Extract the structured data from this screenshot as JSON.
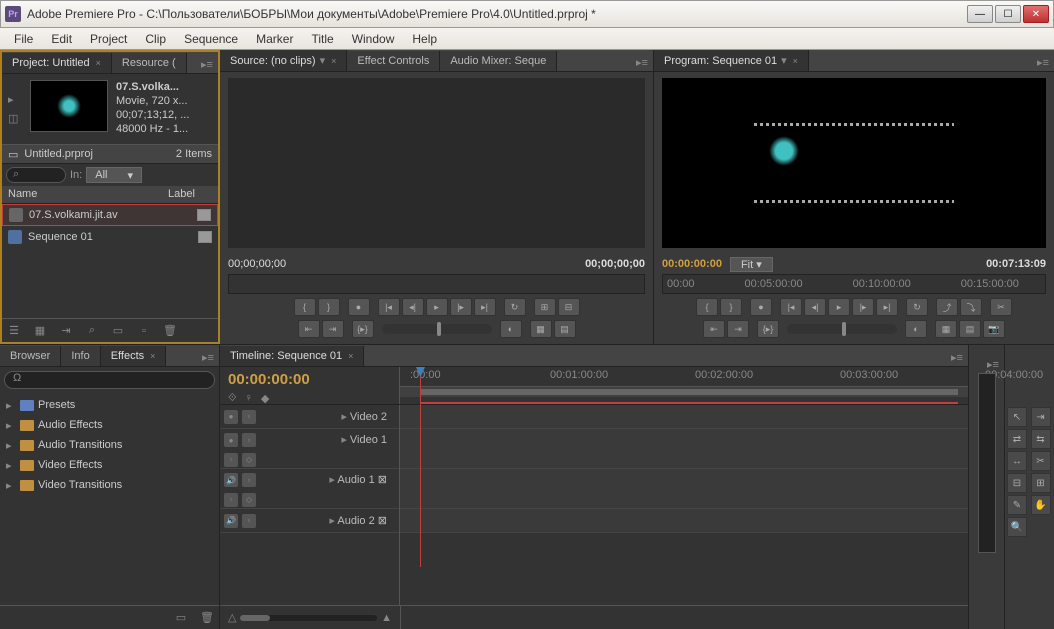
{
  "window": {
    "title": "Adobe Premiere Pro - C:\\Пользователи\\БОБРЫ\\Мои документы\\Adobe\\Premiere Pro\\4.0\\Untitled.prproj *",
    "app_icon": "Pr"
  },
  "menubar": [
    "File",
    "Edit",
    "Project",
    "Clip",
    "Sequence",
    "Marker",
    "Title",
    "Window",
    "Help"
  ],
  "project_panel": {
    "tab_project": "Project: Untitled",
    "tab_resource": "Resource (",
    "selected_clip": {
      "name": "07.S.volka...",
      "type": "Movie, 720 x...",
      "duration": "00;07;13;12, ...",
      "audio": "48000 Hz - 1..."
    },
    "project_name": "Untitled.prproj",
    "item_count": "2 Items",
    "in_label": "In:",
    "in_value": "All",
    "col_name": "Name",
    "col_label": "Label",
    "items": [
      {
        "name": "07.S.volkami.jit.av",
        "selected": true
      },
      {
        "name": "Sequence 01",
        "selected": false
      }
    ]
  },
  "source_panel": {
    "tab_source": "Source: (no clips)",
    "tab_fx": "Effect Controls",
    "tab_audio": "Audio Mixer: Seque",
    "tc_left": "00;00;00;00",
    "tc_right": "00;00;00;00"
  },
  "program_panel": {
    "tab": "Program: Sequence 01",
    "tc_left": "00:00:00:00",
    "fit": "Fit",
    "tc_right": "00:07:13:09",
    "ruler": [
      "00:00",
      "00:05:00:00",
      "00:10:00:00",
      "00:15:00:00"
    ]
  },
  "effects_panel": {
    "tab_browser": "Browser",
    "tab_info": "Info",
    "tab_effects": "Effects",
    "items": [
      "Presets",
      "Audio Effects",
      "Audio Transitions",
      "Video Effects",
      "Video Transitions"
    ]
  },
  "timeline_panel": {
    "tab": "Timeline: Sequence 01",
    "tc": "00:00:00:00",
    "ruler": [
      ":00:00",
      "00:01:00:00",
      "00:02:00:00",
      "00:03:00:00",
      "00:04:00:00"
    ],
    "tracks": {
      "video2": "Video 2",
      "video1": "Video 1",
      "audio1": "Audio 1",
      "audio2": "Audio 2"
    }
  }
}
